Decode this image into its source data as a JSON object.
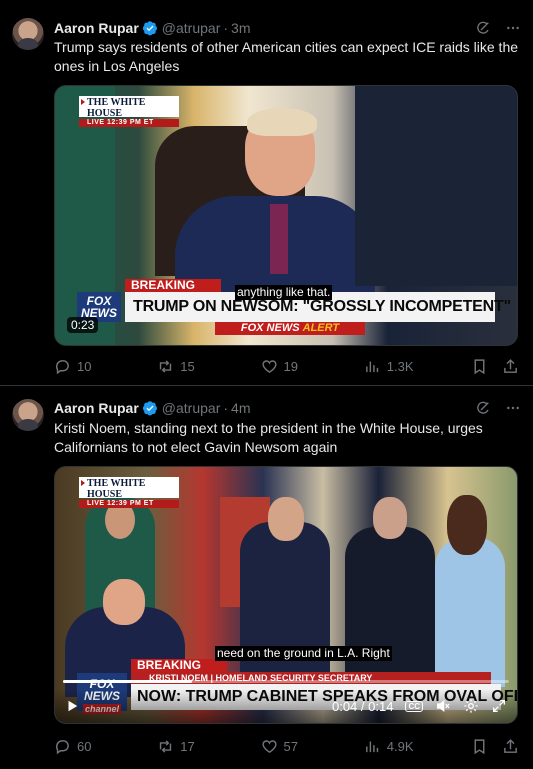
{
  "tweets": [
    {
      "author": "Aaron Rupar",
      "handle": "@atrupar",
      "time": "3m",
      "text": "Trump says residents of other American cities can expect ICE raids like the ones in Los Angeles",
      "video": {
        "badge_title": "THE WHITE HOUSE",
        "badge_live": "LIVE  12:39 PM ET",
        "breaking": "BREAKING NEWS",
        "headline": "TRUMP ON NEWSOM: \"GROSSLY INCOMPETENT\"",
        "network": "FOX NEWS",
        "alert_a": "FOX NEWS",
        "alert_b": "ALERT",
        "caption": "anything like that.",
        "duration": "0:23"
      },
      "stats": {
        "replies": "10",
        "reposts": "15",
        "likes": "19",
        "views": "1.3K"
      }
    },
    {
      "author": "Aaron Rupar",
      "handle": "@atrupar",
      "time": "4m",
      "text": "Kristi Noem, standing next to the president in the White House, urges Californians to not elect Gavin Newsom again",
      "video": {
        "badge_title": "THE WHITE HOUSE",
        "badge_live": "LIVE  12:39 PM ET",
        "breaking": "BREAKING NEWS",
        "nameplate": "KRISTI NOEM | HOMELAND SECURITY SECRETARY",
        "headline": "NOW: TRUMP CABINET SPEAKS FROM OVAL OFFICE",
        "network": "FOX NEWS",
        "network_sub": "channel",
        "caption": "need on the ground in L.A. Right",
        "time_display": "0:04 / 0:14",
        "cc_label": "CC",
        "progress": 0.29
      },
      "stats": {
        "replies": "60",
        "reposts": "17",
        "likes": "57",
        "views": "4.9K"
      }
    }
  ],
  "colors": {
    "verified": "#1d9bf0",
    "muted": "#71767b",
    "breaking": "#c01d1d",
    "alert_gold": "#f4c21a"
  }
}
